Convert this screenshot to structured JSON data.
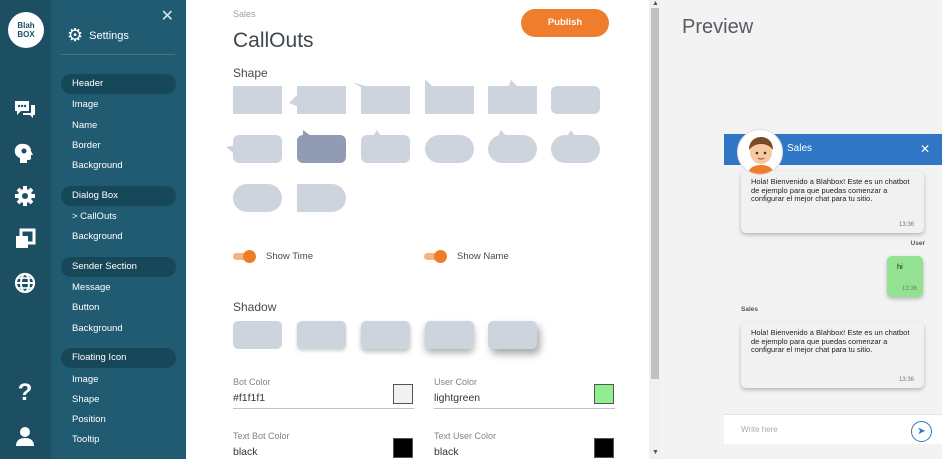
{
  "logo": {
    "line1": "Blah",
    "line2": "BOX"
  },
  "rail_icons": [
    "chat-icon",
    "head-icon",
    "gear-icon",
    "window-icon",
    "globe-icon",
    "help-icon",
    "user-icon"
  ],
  "sidebar": {
    "title": "Settings",
    "groups": [
      {
        "label": "Header",
        "items": [
          "Image",
          "Name",
          "Border",
          "Background"
        ]
      },
      {
        "label": "Dialog Box",
        "items": [
          "> CallOuts",
          "Background"
        ]
      },
      {
        "label": "Sender Section",
        "items": [
          "Message",
          "Button",
          "Background"
        ]
      },
      {
        "label": "Floating Icon",
        "items": [
          "Image",
          "Shape",
          "Position",
          "Tooltip"
        ]
      }
    ]
  },
  "main": {
    "breadcrumb": "Sales",
    "title": "CallOuts",
    "publish_label": "Publish",
    "shape_label": "Shape",
    "shadow_label": "Shadow",
    "toggles": {
      "show_time": "Show Time",
      "show_name": "Show Name"
    },
    "fields": {
      "bot_color": {
        "label": "Bot Color",
        "value": "#f1f1f1",
        "swatch": "#f1f1f1"
      },
      "user_color": {
        "label": "User Color",
        "value": "lightgreen",
        "swatch": "#90ee90"
      },
      "text_bot_color": {
        "label": "Text Bot Color",
        "value": "black",
        "swatch": "#000000"
      },
      "text_user_color": {
        "label": "Text User Color",
        "value": "black",
        "swatch": "#000000"
      }
    }
  },
  "preview": {
    "title": "Preview",
    "header_name": "Sales",
    "messages": [
      {
        "sender": "",
        "text": "Hola! Bienvenido a Blahbox! Este es un chatbot de ejemplo para que puedas comenzar a configurar el mejor chat para tu sitio.",
        "time": "13:36"
      },
      {
        "sender": "User",
        "text": "hi",
        "time": "13:36"
      },
      {
        "sender": "Sales",
        "text": "Hola! Bienvenido a Blahbox! Este es un chatbot de ejemplo para que puedas comenzar a configurar el mejor chat para tu sitio.",
        "time": "13:36"
      }
    ],
    "input_placeholder": "Write here"
  },
  "colors": {
    "accent": "#ef7d2b",
    "sidebar": "#215b72",
    "rail": "#1d4f63",
    "chat_header": "#2f76c4",
    "user_bubble": "#93e292",
    "selected_shape": "#919bb3"
  }
}
